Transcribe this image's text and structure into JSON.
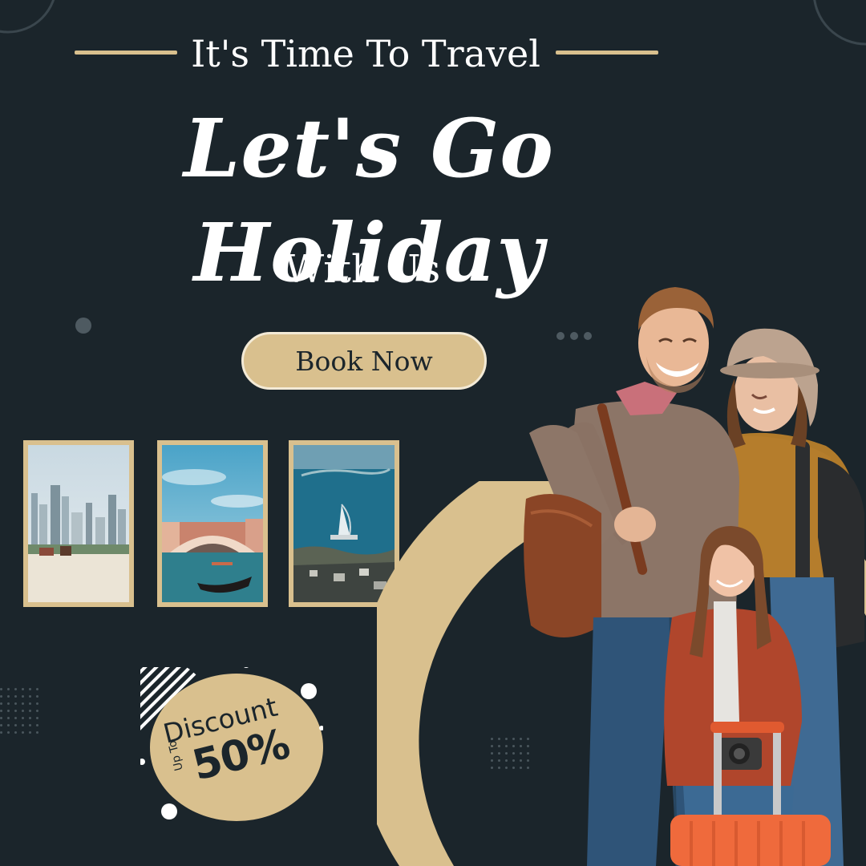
{
  "header": {
    "eyebrow": "It's Time To Travel",
    "headline": "Let's Go Holiday",
    "subhead": "With Us"
  },
  "cta": {
    "label": "Book Now"
  },
  "gallery": [
    {
      "icon": "city-beach-photo"
    },
    {
      "icon": "venice-bridge-photo"
    },
    {
      "icon": "dubai-palm-photo"
    }
  ],
  "discount": {
    "label": "Discount",
    "prefix": "Up To",
    "value": "50%"
  },
  "colors": {
    "background": "#1b252b",
    "accent": "#d9c08e",
    "text": "#ffffff"
  }
}
